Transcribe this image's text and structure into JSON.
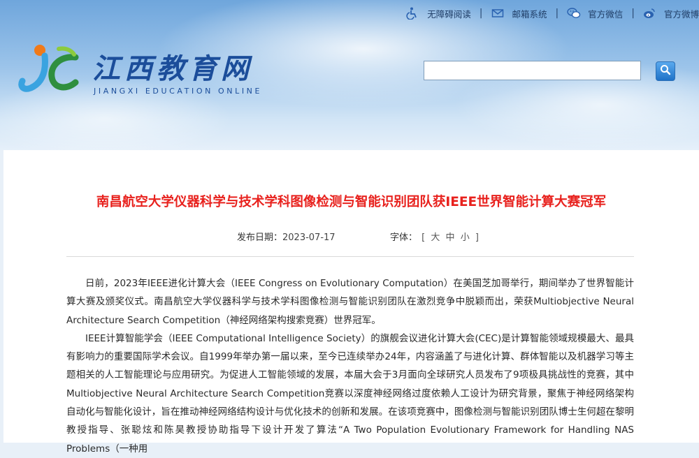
{
  "topbar": {
    "accessibility": "无障碍阅读",
    "email": "邮箱系统",
    "wechat": "官方微信",
    "weibo": "官方微博",
    "separator": "|"
  },
  "site": {
    "name_cn": "江西教育网",
    "name_en": "JIANGXI EDUCATION ONLINE"
  },
  "search": {
    "value": "",
    "placeholder": ""
  },
  "article": {
    "title": "南昌航空大学仪器科学与技术学科图像检测与智能识别团队获IEEE世界智能计算大赛冠军",
    "date_label": "发布日期：",
    "date": "2023-07-17",
    "font_label": "字体：",
    "font_open": "[",
    "font_large": "大",
    "font_medium": "中",
    "font_small": "小",
    "font_close": "]",
    "paragraphs": [
      "日前，2023年IEEE进化计算大会（IEEE Congress on Evolutionary Computation）在美国芝加哥举行，期间举办了世界智能计算大赛及颁奖仪式。南昌航空大学仪器科学与技术学科图像检测与智能识别团队在激烈竞争中脱颖而出，荣获Multiobjective Neural Architecture Search Competition（神经网络架构搜索竞赛）世界冠军。",
      "IEEE计算智能学会（IEEE Computational Intelligence Society）的旗舰会议进化计算大会(CEC)是计算智能领域规模最大、最具有影响力的重要国际学术会议。自1999年举办第一届以来，至今已连续举办24年，内容涵盖了与进化计算、群体智能以及机器学习等主题相关的人工智能理论与应用研究。为促进人工智能领域的发展，本届大会于3月面向全球研究人员发布了9项极具挑战性的竞赛，其中Multiobjective Neural Architecture Search Competition竞赛以深度神经网络过度依赖人工设计为研究背景，聚焦于神经网络架构自动化与智能化设计，旨在推动神经网络结构设计与优化技术的创新和发展。在该项竞赛中，图像检测与智能识别团队博士生何超在黎明教授指导、张聪炫和陈昊教授协助指导下设计开发了算法“A Two Population Evolutionary Framework for Handling NAS Problems（一种用"
    ]
  },
  "colors": {
    "title_red": "#e8211d",
    "brand_blue": "#1b4d9a",
    "link_text": "#1f3d66"
  }
}
